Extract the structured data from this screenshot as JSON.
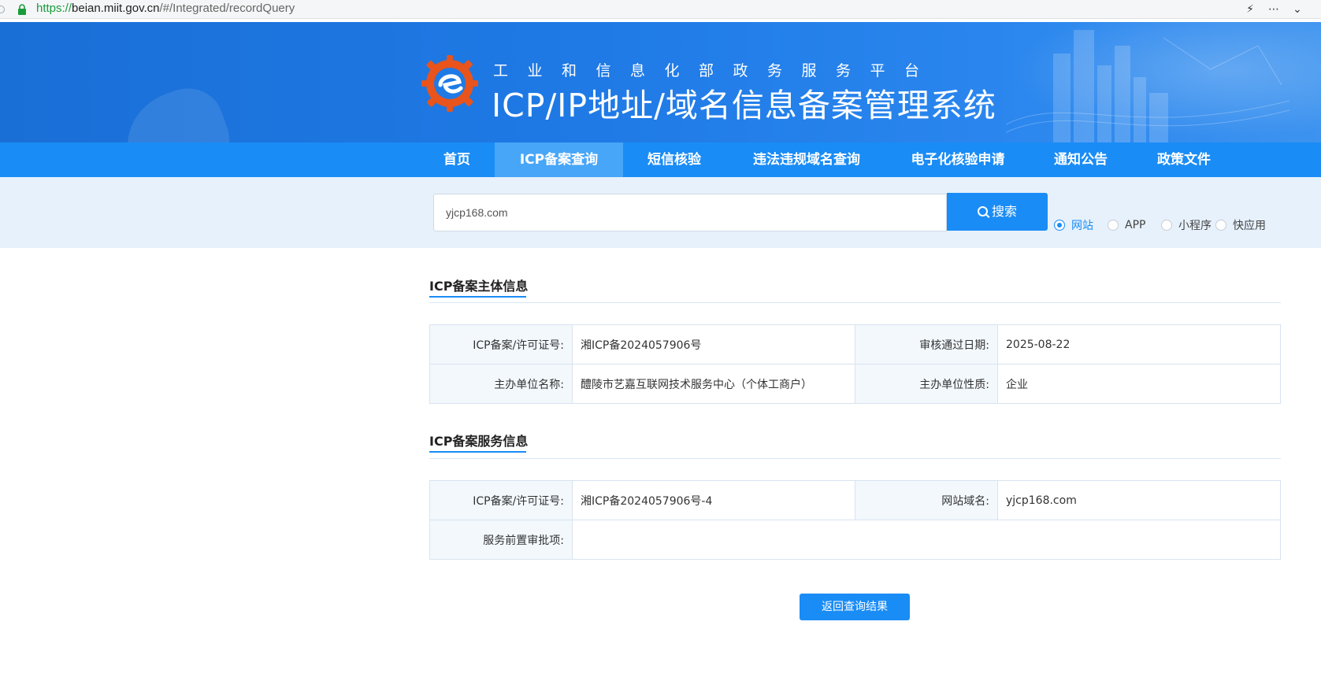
{
  "browser": {
    "url_protocol": "https://",
    "url_host": "beian.miit.gov.cn",
    "url_path": "/#/Integrated/recordQuery"
  },
  "header": {
    "subtitle": "工业和信息化部政务服务平台",
    "title": "ICP/IP地址/域名信息备案管理系统"
  },
  "nav": {
    "items": [
      {
        "label": "首页",
        "active": false
      },
      {
        "label": "ICP备案查询",
        "active": true
      },
      {
        "label": "短信核验",
        "active": false
      },
      {
        "label": "违法违规域名查询",
        "active": false
      },
      {
        "label": "电子化核验申请",
        "active": false
      },
      {
        "label": "通知公告",
        "active": false
      },
      {
        "label": "政策文件",
        "active": false
      }
    ]
  },
  "search": {
    "value": "yjcp168.com",
    "button_label": "搜索",
    "options": [
      {
        "label": "网站",
        "selected": true
      },
      {
        "label": "APP",
        "selected": false
      },
      {
        "label": "小程序",
        "selected": false
      },
      {
        "label": "快应用",
        "selected": false
      }
    ]
  },
  "subject_section": {
    "title": "ICP备案主体信息",
    "rows": [
      {
        "label1": "ICP备案/许可证号:",
        "value1": "湘ICP备2024057906号",
        "label2": "审核通过日期:",
        "value2": "2025-08-22"
      },
      {
        "label1": "主办单位名称:",
        "value1": "醴陵市艺嘉互联网技术服务中心（个体工商户）",
        "label2": "主办单位性质:",
        "value2": "企业"
      }
    ]
  },
  "service_section": {
    "title": "ICP备案服务信息",
    "license_label": "ICP备案/许可证号:",
    "license_value": "湘ICP备2024057906号-4",
    "domain_label": "网站域名:",
    "domain_value": "yjcp168.com",
    "approval_label": "服务前置审批项:",
    "approval_value": ""
  },
  "back_button_label": "返回查询结果",
  "colors": {
    "primary": "#1a8cf5",
    "nav_active": "#47a6f8",
    "banner": "#1f7ae6",
    "search_band": "#e6f1fc",
    "label_cell": "#f3f8fd"
  }
}
